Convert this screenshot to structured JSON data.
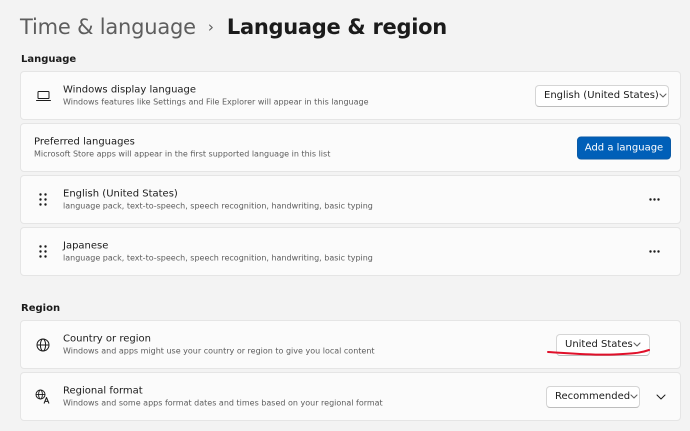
{
  "breadcrumb": {
    "parent": "Time & language",
    "separator": "›",
    "current": "Language & region"
  },
  "language_section": {
    "title": "Language",
    "display_language": {
      "title": "Windows display language",
      "subtitle": "Windows features like Settings and File Explorer will appear in this language",
      "value": "English (United States)",
      "icon": "laptop-icon"
    },
    "preferred_languages": {
      "title": "Preferred languages",
      "subtitle": "Microsoft Store apps will appear in the first supported language in this list",
      "button_label": "Add a language"
    },
    "languages": [
      {
        "name": "English (United States)",
        "features": "language pack, text-to-speech, speech recognition, handwriting, basic typing"
      },
      {
        "name": "Japanese",
        "features": "language pack, text-to-speech, speech recognition, handwriting, basic typing"
      }
    ]
  },
  "region_section": {
    "title": "Region",
    "country": {
      "title": "Country or region",
      "subtitle": "Windows and apps might use your country or region to give you local content",
      "value": "United States",
      "icon": "globe-icon"
    },
    "regional_format": {
      "title": "Regional format",
      "subtitle": "Windows and some apps format dates and times based on your regional format",
      "value": "Recommended",
      "icon": "regional-format-icon"
    }
  },
  "colors": {
    "accent": "#005fb8",
    "annotation": "#e0102a",
    "background": "#f3f3f3",
    "card": "#fbfbfb"
  }
}
